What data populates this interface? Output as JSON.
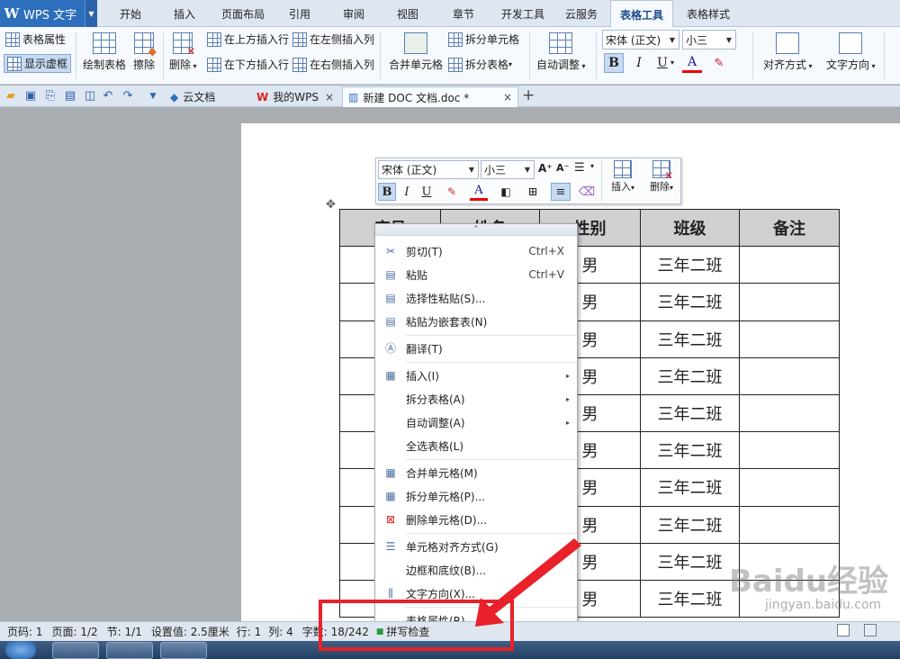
{
  "app": {
    "name": "WPS 文字",
    "logo": "W"
  },
  "menu_tabs": [
    "开始",
    "插入",
    "页面布局",
    "引用",
    "审阅",
    "视图",
    "章节",
    "开发工具",
    "云服务",
    "表格工具",
    "表格样式"
  ],
  "active_tab": "表格工具",
  "ribbon": {
    "table_props": "表格属性",
    "show_gridlines": "显示虚框",
    "draw_table": "绘制表格",
    "eraser": "擦除",
    "delete": "删除",
    "insert_above": "在上方插入行",
    "insert_below": "在下方插入行",
    "insert_left": "在左侧插入列",
    "insert_right": "在右侧插入列",
    "merge_cells": "合并单元格",
    "split_cells": "拆分单元格",
    "split_table": "拆分表格",
    "auto_fit": "自动调整",
    "font_name": "宋体 (正文)",
    "font_size": "小三",
    "align": "对齐方式",
    "text_dir": "文字方向",
    "bold": "B",
    "italic": "I",
    "underline": "U",
    "font_color": "A"
  },
  "doc_tabs": [
    {
      "label": "云文档",
      "active": false
    },
    {
      "label": "我的WPS",
      "active": false
    },
    {
      "label": "新建 DOC 文档.doc *",
      "active": true
    }
  ],
  "mini_toolbar": {
    "font_name": "宋体 (正文)",
    "font_size": "小三",
    "insert": "插入",
    "delete": "删除"
  },
  "table": {
    "headers": [
      "序号",
      "姓名",
      "性别",
      "班级",
      "备注"
    ],
    "rows": [
      [
        "",
        "",
        "男",
        "三年二班",
        ""
      ],
      [
        "",
        "",
        "男",
        "三年二班",
        ""
      ],
      [
        "",
        "",
        "男",
        "三年二班",
        ""
      ],
      [
        "",
        "",
        "男",
        "三年二班",
        ""
      ],
      [
        "",
        "",
        "男",
        "三年二班",
        ""
      ],
      [
        "",
        "",
        "男",
        "三年二班",
        ""
      ],
      [
        "",
        "",
        "男",
        "三年二班",
        ""
      ],
      [
        "",
        "",
        "男",
        "三年二班",
        ""
      ],
      [
        "",
        "",
        "男",
        "三年二班",
        ""
      ],
      [
        "",
        "",
        "男",
        "三年二班",
        ""
      ]
    ]
  },
  "context_menu": {
    "items": [
      {
        "label": "剪切(T)",
        "shortcut": "Ctrl+X",
        "icon": "scissors-icon"
      },
      {
        "label": "粘贴",
        "shortcut": "Ctrl+V",
        "icon": "paste-icon"
      },
      {
        "label": "选择性粘贴(S)...",
        "shortcut": "",
        "icon": "paste-special-icon"
      },
      {
        "label": "粘贴为嵌套表(N)",
        "shortcut": "",
        "icon": "paste-nested-icon"
      },
      {
        "label": "翻译(T)",
        "shortcut": "",
        "icon": "translate-icon"
      },
      {
        "label": "插入(I)",
        "shortcut": "",
        "icon": "table-icon",
        "submenu": true
      },
      {
        "label": "拆分表格(A)",
        "shortcut": "",
        "icon": "",
        "submenu": true
      },
      {
        "label": "自动调整(A)",
        "shortcut": "",
        "icon": "",
        "submenu": true
      },
      {
        "label": "全选表格(L)",
        "shortcut": "",
        "icon": ""
      },
      {
        "label": "合并单元格(M)",
        "shortcut": "",
        "icon": "merge-icon"
      },
      {
        "label": "拆分单元格(P)...",
        "shortcut": "",
        "icon": "split-icon"
      },
      {
        "label": "删除单元格(D)...",
        "shortcut": "",
        "icon": "delete-cell-icon"
      },
      {
        "label": "单元格对齐方式(G)",
        "shortcut": "",
        "icon": "align-icon",
        "submenu": true
      },
      {
        "label": "边框和底纹(B)...",
        "shortcut": "",
        "icon": ""
      },
      {
        "label": "文字方向(X)...",
        "shortcut": "",
        "icon": "text-direction-icon"
      },
      {
        "label": "表格属性(R)...",
        "shortcut": "",
        "icon": ""
      }
    ]
  },
  "status": {
    "page": "页码: 1",
    "pages": "页面: 1/2",
    "section": "节: 1/1",
    "setting": "设置值: 2.5厘米",
    "row": "行: 1",
    "col": "列: 4",
    "words": "字数: 18/242",
    "spell": "拼写检查"
  },
  "watermark": {
    "text": "Baidu经验",
    "sub": "jingyan.baidu.com"
  },
  "colors": {
    "accent": "#2e6fbd",
    "annotation": "#e8212a"
  }
}
